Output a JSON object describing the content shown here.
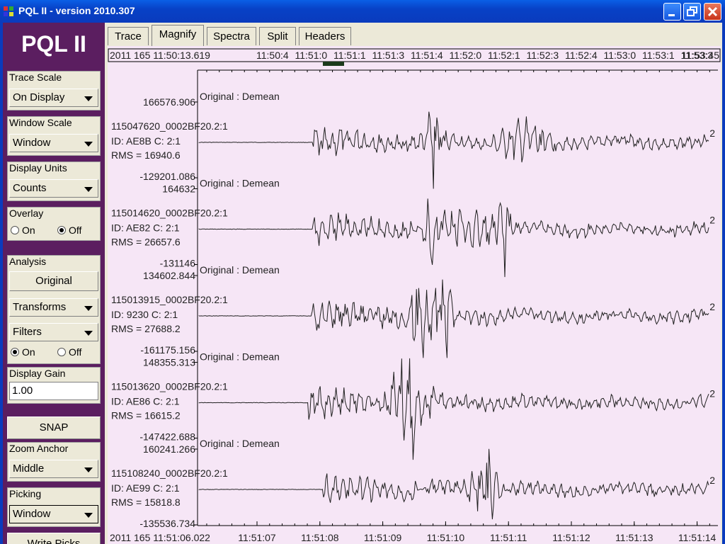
{
  "window": {
    "title": "PQL II - version 2010.307",
    "minimize_label": "minimize",
    "maximize_label": "maximize",
    "close_label": "close"
  },
  "sidebar": {
    "logo": "PQL II",
    "trace_scale": {
      "label": "Trace Scale",
      "value": "On Display"
    },
    "window_scale": {
      "label": "Window Scale",
      "value": "Window"
    },
    "display_units": {
      "label": "Display Units",
      "value": "Counts"
    },
    "overlay": {
      "label": "Overlay",
      "on": "On",
      "off": "Off",
      "selected": "Off"
    },
    "analysis": {
      "label": "Analysis",
      "original": "Original",
      "transforms": "Transforms",
      "filters": "Filters",
      "on": "On",
      "off": "Off",
      "selected": "On"
    },
    "display_gain": {
      "label": "Display Gain",
      "value": "1.00"
    },
    "snap": "SNAP",
    "zoom_anchor": {
      "label": "Zoom Anchor",
      "value": "Middle"
    },
    "picking": {
      "label": "Picking",
      "value": "Window"
    },
    "write_picks": "Write Picks"
  },
  "tabs": [
    "Trace",
    "Magnify",
    "Spectra",
    "Split",
    "Headers"
  ],
  "active_tab": "Magnify",
  "overview": {
    "start": "2011 165 11:50:13.619",
    "ticks": [
      "11:50:4",
      "11:51:0",
      "11:51:1",
      "11:51:3",
      "11:51:4",
      "11:52:0",
      "11:52:1",
      "11:52:3",
      "11:52:4",
      "11:53:0",
      "11:53:1",
      "11:53:3",
      "11:53:45"
    ]
  },
  "x_axis": {
    "start": "2011 165 11:51:06.022",
    "ticks": [
      "11:51:07",
      "11:51:08",
      "11:51:09",
      "11:51:10",
      "11:51:11",
      "11:51:12",
      "11:51:13",
      "11:51:14"
    ]
  },
  "chart_data": {
    "type": "line",
    "traces": [
      {
        "header": "Original : Demean",
        "max": "166576.906",
        "id": "115047620_0002BF20.2:1",
        "info": "ID: AE8B C: 2:1",
        "rms": "RMS = 16940.6",
        "min": "-129201.086",
        "channel": "2"
      },
      {
        "header": "Original : Demean",
        "max": "164632",
        "id": "115014620_0002BF20.2:1",
        "info": "ID: AE82 C: 2:1",
        "rms": "RMS = 26657.6",
        "min": "-131146",
        "channel": "2"
      },
      {
        "header": "Original : Demean",
        "max": "134602.844",
        "id": "115013915_0002BF20.2:1",
        "info": "ID: 9230 C: 2:1",
        "rms": "RMS = 27688.2",
        "min": "-161175.156",
        "channel": "2"
      },
      {
        "header": "Original : Demean",
        "max": "148355.313",
        "id": "115013620_0002BF20.2:1",
        "info": "ID: AE86 C: 2:1",
        "rms": "RMS = 16615.2",
        "min": "-147422.688",
        "channel": "2"
      },
      {
        "header": "Original : Demean",
        "max": "160241.266",
        "id": "115108240_0002BF20.2:1",
        "info": "ID: AE99 C: 2:1",
        "rms": "RMS = 15818.8",
        "min": "-135536.734",
        "channel": "2"
      }
    ]
  },
  "colors": {
    "plot_bg": "#f6e6f6",
    "sidebar": "#5b1e60",
    "trace": "#202020"
  }
}
